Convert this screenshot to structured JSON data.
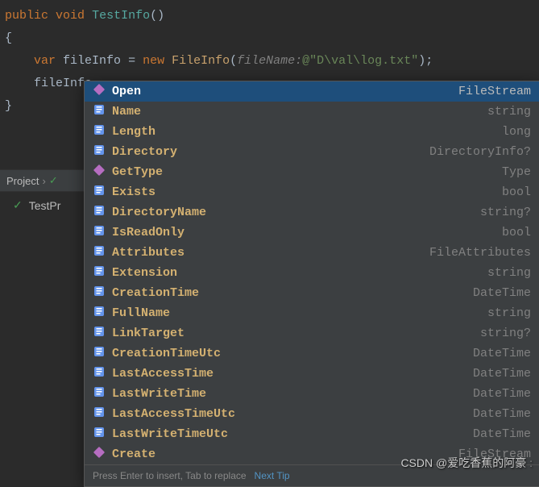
{
  "code": {
    "line1": {
      "public": "public",
      "void": "void",
      "method": "TestInfo",
      "parens": "()"
    },
    "line2": "{",
    "line3": {
      "indent": "    ",
      "var": "var",
      "ident": "fileInfo",
      "eq": " = ",
      "new": "new",
      "type": "FileInfo",
      "paramName": "fileName:",
      "at": "@",
      "str": "\"D\\val\\log.txt\"",
      "end": ");"
    },
    "line4": {
      "indent": "    ",
      "ident": "fileInfo",
      "dot": "."
    },
    "line5": "}"
  },
  "breadcrumb": {
    "project": "Project",
    "sep": "›"
  },
  "bottom": {
    "testLabel": "TestPr"
  },
  "intellisense": {
    "items": [
      {
        "icon": "method",
        "label": "Open",
        "type": "FileStream",
        "selected": true
      },
      {
        "icon": "property",
        "label": "Name",
        "type": "string"
      },
      {
        "icon": "property",
        "label": "Length",
        "type": "long"
      },
      {
        "icon": "property",
        "label": "Directory",
        "type": "DirectoryInfo?"
      },
      {
        "icon": "method",
        "label": "GetType",
        "type": "Type"
      },
      {
        "icon": "property",
        "label": "Exists",
        "type": "bool"
      },
      {
        "icon": "property",
        "label": "DirectoryName",
        "type": "string?"
      },
      {
        "icon": "property",
        "label": "IsReadOnly",
        "type": "bool"
      },
      {
        "icon": "property",
        "label": "Attributes",
        "type": "FileAttributes"
      },
      {
        "icon": "property",
        "label": "Extension",
        "type": "string"
      },
      {
        "icon": "property",
        "label": "CreationTime",
        "type": "DateTime"
      },
      {
        "icon": "property",
        "label": "FullName",
        "type": "string"
      },
      {
        "icon": "property",
        "label": "LinkTarget",
        "type": "string?"
      },
      {
        "icon": "property",
        "label": "CreationTimeUtc",
        "type": "DateTime"
      },
      {
        "icon": "property",
        "label": "LastAccessTime",
        "type": "DateTime"
      },
      {
        "icon": "property",
        "label": "LastWriteTime",
        "type": "DateTime"
      },
      {
        "icon": "property",
        "label": "LastAccessTimeUtc",
        "type": "DateTime"
      },
      {
        "icon": "property",
        "label": "LastWriteTimeUtc",
        "type": "DateTime"
      },
      {
        "icon": "method",
        "label": "Create",
        "type": "FileStream"
      }
    ],
    "footer": {
      "hint": "Press Enter to insert, Tab to replace",
      "nextTip": "Next Tip"
    }
  },
  "watermark": {
    "prefix": "CSDN",
    "handle": "@爱吃香蕉的阿豪"
  }
}
